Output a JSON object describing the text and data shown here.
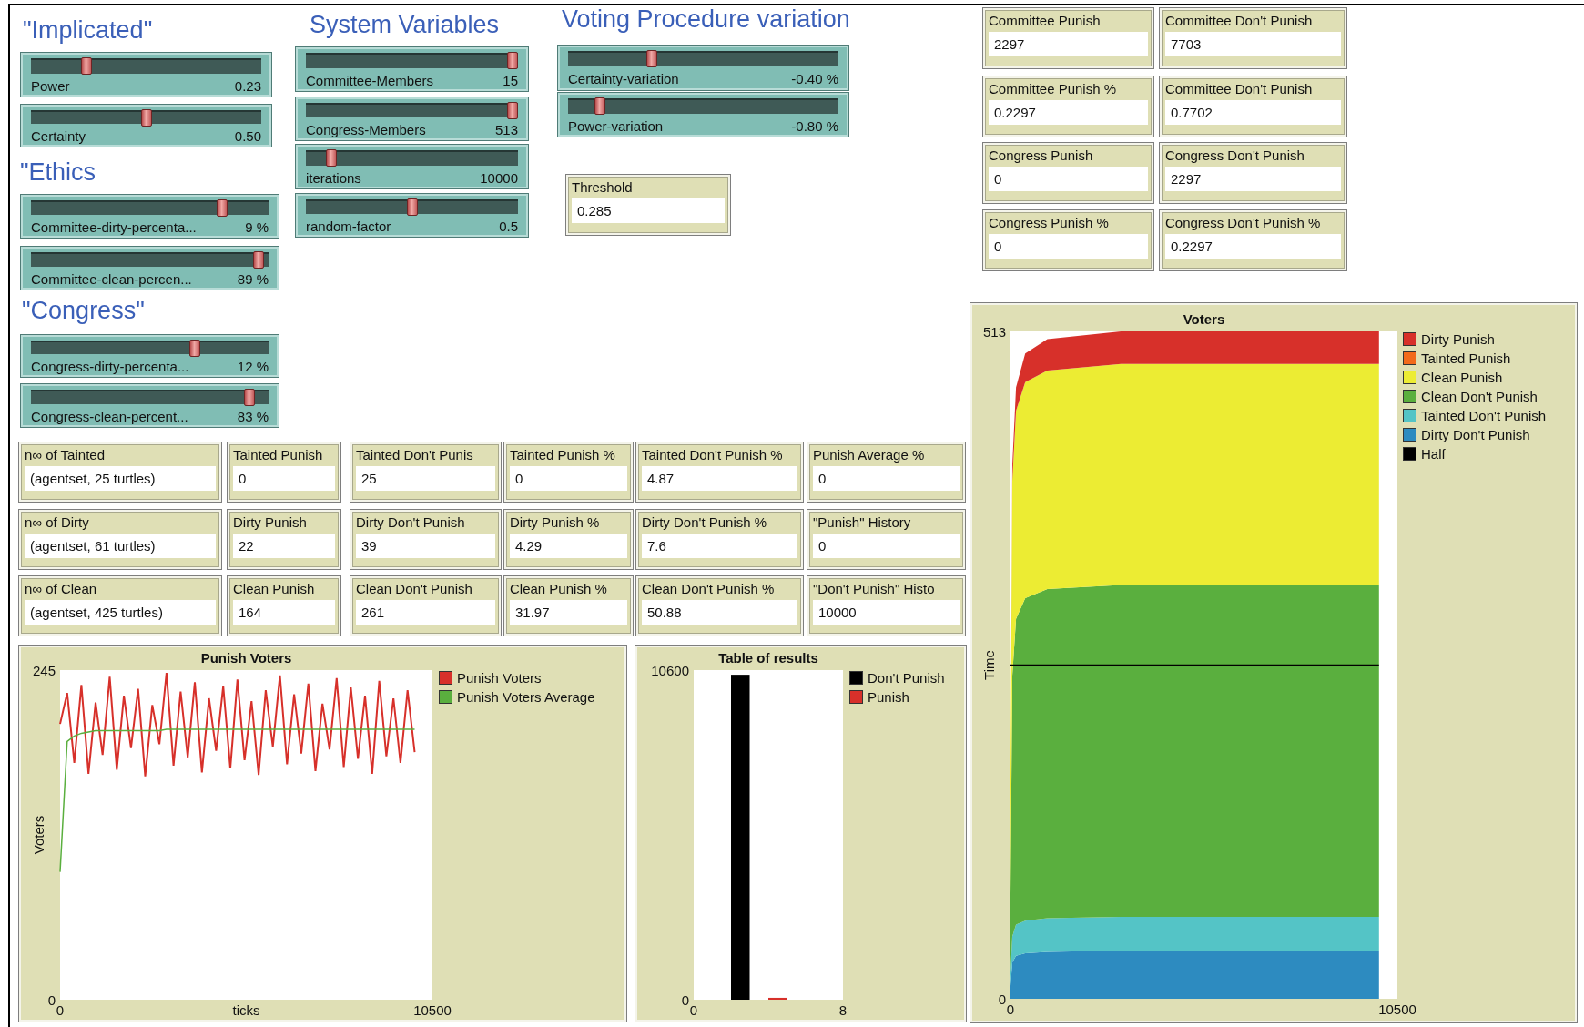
{
  "implicated": {
    "title": "\"Implicated\"",
    "sliders": [
      {
        "label": "Power",
        "reading": "0.23",
        "level": 0.23
      },
      {
        "label": "Certainty",
        "reading": "0.50",
        "level": 0.5
      }
    ]
  },
  "ethics": {
    "title": "\"Ethics",
    "sliders": [
      {
        "label": "Committee-dirty-percenta...",
        "reading": "9 %",
        "level": 0.82
      },
      {
        "label": "Committee-clean-percen...",
        "reading": "89 %",
        "level": 0.98
      }
    ]
  },
  "congress": {
    "title": "\"Congress\"",
    "sliders": [
      {
        "label": "Congress-dirty-percenta...",
        "reading": "12 %",
        "level": 0.7
      },
      {
        "label": "Congress-clean-percent...",
        "reading": "83 %",
        "level": 0.94
      }
    ]
  },
  "system_variables": {
    "title": "System Variables",
    "sliders": [
      {
        "label": "Committee-Members",
        "reading": "15",
        "level": 1
      },
      {
        "label": "Congress-Members",
        "reading": "513",
        "level": 1
      },
      {
        "label": "iterations",
        "reading": "10000",
        "level": 0.1
      },
      {
        "label": "random-factor",
        "reading": "0.5",
        "level": 0.5
      }
    ]
  },
  "voting_procedure": {
    "title": "Voting Procedure variation",
    "sliders": [
      {
        "label": "Certainty-variation",
        "reading": "-0.40 %",
        "level": 0.3
      },
      {
        "label": "Power-variation",
        "reading": "-0.80 %",
        "level": 0.1
      }
    ]
  },
  "threshold": {
    "label": "Threshold",
    "value": "0.285"
  },
  "results_monitors": [
    {
      "label": "Committee Punish",
      "value": "2297"
    },
    {
      "label": "Committee Don't Punish",
      "value": "7703"
    },
    {
      "label": "Committee Punish %",
      "value": "0.2297"
    },
    {
      "label": "Committee Don't Punish",
      "value": "0.7702"
    },
    {
      "label": "Congress Punish",
      "value": "0"
    },
    {
      "label": "Congress Don't Punish",
      "value": "2297"
    },
    {
      "label": "Congress Punish %",
      "value": "0"
    },
    {
      "label": "Congress Don't Punish %",
      "value": "0.2297"
    }
  ],
  "group_monitors": [
    {
      "label": "n∞ of Tainted",
      "value": "(agentset, 25 turtles)"
    },
    {
      "label": "Tainted Punish",
      "value": "0"
    },
    {
      "label": "Tainted Don't Punis",
      "value": "25"
    },
    {
      "label": "Tainted Punish %",
      "value": "0"
    },
    {
      "label": "Tainted Don't Punish %",
      "value": "4.87"
    },
    {
      "label": "Punish Average %",
      "value": "0"
    },
    {
      "label": "n∞ of Dirty",
      "value": "(agentset, 61 turtles)"
    },
    {
      "label": "Dirty Punish",
      "value": "22"
    },
    {
      "label": "Dirty Don't Punish",
      "value": "39"
    },
    {
      "label": "Dirty Punish %",
      "value": "4.29"
    },
    {
      "label": "Dirty Don't Punish %",
      "value": "7.6"
    },
    {
      "label": "\"Punish\" History",
      "value": "0"
    },
    {
      "label": "n∞ of Clean",
      "value": "(agentset, 425 turtles)"
    },
    {
      "label": "Clean Punish",
      "value": "164"
    },
    {
      "label": "Clean Don't Punish",
      "value": "261"
    },
    {
      "label": "Clean Punish %",
      "value": "31.97"
    },
    {
      "label": "Clean Don't Punish %",
      "value": "50.88"
    },
    {
      "label": "\"Don't Punish\" Histo",
      "value": "10000"
    }
  ],
  "punish_voters_plot": {
    "chart_data": {
      "type": "line",
      "title": "Punish Voters",
      "xlabel": "ticks",
      "ylabel": "Voters",
      "x": [
        0,
        200,
        400,
        600,
        800,
        1000,
        1200,
        1400,
        1600,
        1800,
        2000,
        2200,
        2400,
        2600,
        2800,
        3000,
        3200,
        3400,
        3600,
        3800,
        4000,
        4200,
        4400,
        4600,
        4800,
        5000,
        5200,
        5400,
        5600,
        5800,
        6000,
        6200,
        6400,
        6600,
        6800,
        7000,
        7200,
        7400,
        7600,
        7800,
        8000,
        8200,
        8400,
        8600,
        8800,
        9000,
        9200,
        9400,
        9600,
        9800,
        10000
      ],
      "series": [
        {
          "name": "Punish Voters",
          "color": "#d7302a",
          "values": [
            205,
            228,
            176,
            234,
            168,
            221,
            182,
            240,
            171,
            226,
            187,
            231,
            166,
            219,
            190,
            243,
            174,
            229,
            180,
            236,
            169,
            224,
            185,
            233,
            172,
            238,
            178,
            222,
            167,
            230,
            188,
            241,
            175,
            227,
            183,
            235,
            170,
            220,
            186,
            239,
            173,
            232,
            179,
            226,
            168,
            237,
            181,
            224,
            176,
            230,
            184
          ]
        },
        {
          "name": "Punish Voters Average",
          "color": "#5aaf3e",
          "values": [
            95,
            192,
            196,
            198,
            199,
            200,
            200,
            200,
            200,
            200,
            200,
            200,
            200,
            200,
            200,
            201,
            201,
            201,
            201,
            201,
            201,
            201,
            201,
            201,
            201,
            201,
            201,
            201,
            201,
            201,
            201,
            201,
            201,
            201,
            201,
            201,
            201,
            201,
            201,
            201,
            201,
            201,
            201,
            201,
            201,
            201,
            201,
            201,
            201,
            201,
            201
          ]
        }
      ],
      "xlim": [
        0,
        10500
      ],
      "ylim": [
        0,
        245
      ],
      "xticks": [
        0,
        10500
      ],
      "yticks": [
        0,
        245
      ]
    }
  },
  "table_of_results_plot": {
    "chart_data": {
      "type": "bar",
      "title": "Table of results",
      "x": [
        2,
        4
      ],
      "series": [
        {
          "name": "Don't Punish",
          "color": "#000000",
          "values": [
            10450,
            null
          ]
        },
        {
          "name": "Punish",
          "color": "#d7302a",
          "values": [
            null,
            60
          ]
        }
      ],
      "xlim": [
        0,
        8
      ],
      "ylim": [
        0,
        10600
      ],
      "xticks": [
        0,
        8
      ],
      "yticks": [
        0,
        10600
      ]
    }
  },
  "voters_plot": {
    "chart_data": {
      "type": "area",
      "title": "Voters",
      "ylabel": "Time",
      "stacked": true,
      "x": [
        0,
        50,
        150,
        400,
        1000,
        3000,
        10000
      ],
      "series": [
        {
          "name": "Dirty Don't Punish",
          "color": "#2d8bc0",
          "values": [
            10,
            28,
            33,
            35,
            36,
            37,
            37
          ]
        },
        {
          "name": "Tainted Don't Punish",
          "color": "#54c4c6",
          "values": [
            10,
            20,
            24,
            25,
            26,
            26,
            26
          ]
        },
        {
          "name": "Clean Don't Punish",
          "color": "#5aaf3e",
          "values": [
            60,
            200,
            235,
            248,
            253,
            255,
            255
          ]
        },
        {
          "name": "Clean Punish",
          "color": "#ecec33",
          "values": [
            90,
            150,
            160,
            166,
            168,
            170,
            170
          ]
        },
        {
          "name": "Tainted Punish",
          "color": "#f26a1b",
          "values": [
            null,
            null,
            null,
            null,
            null,
            null,
            null
          ]
        },
        {
          "name": "Dirty Punish",
          "color": "#d7302a",
          "values": [
            0,
            12,
            18,
            22,
            24,
            25,
            25
          ]
        }
      ],
      "ref_lines": [
        {
          "axis": "y",
          "value": 256.5,
          "label": "Half",
          "color": "#000000"
        }
      ],
      "xlim": [
        0,
        10500
      ],
      "ylim": [
        0,
        513
      ],
      "xticks": [
        0,
        10500
      ],
      "yticks": [
        0,
        513
      ]
    }
  }
}
